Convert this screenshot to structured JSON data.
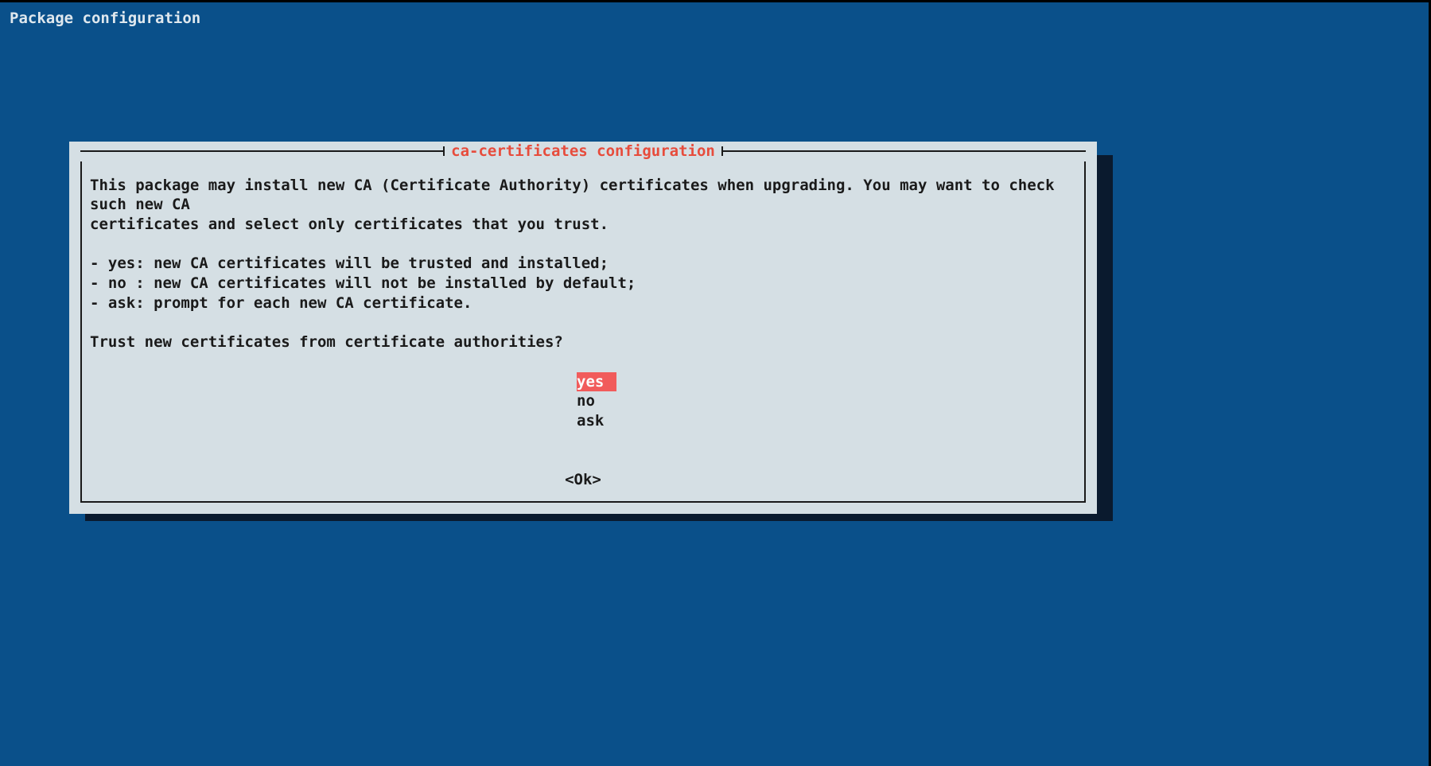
{
  "header": {
    "title": "Package configuration"
  },
  "dialog": {
    "title": " ca-certificates configuration ",
    "description_line1": "This package may install new CA (Certificate Authority) certificates when upgrading. You may want to check such new CA",
    "description_line2": "certificates and select only certificates that you trust.",
    "option_descriptions": [
      " - yes: new CA certificates will be trusted and installed;",
      " - no : new CA certificates will not be installed by default;",
      " - ask: prompt for each new CA certificate."
    ],
    "question": "Trust new certificates from certificate authorities?",
    "options": [
      {
        "label": "yes",
        "selected": true
      },
      {
        "label": "no",
        "selected": false
      },
      {
        "label": "ask",
        "selected": false
      }
    ],
    "ok_button": "<Ok>"
  }
}
